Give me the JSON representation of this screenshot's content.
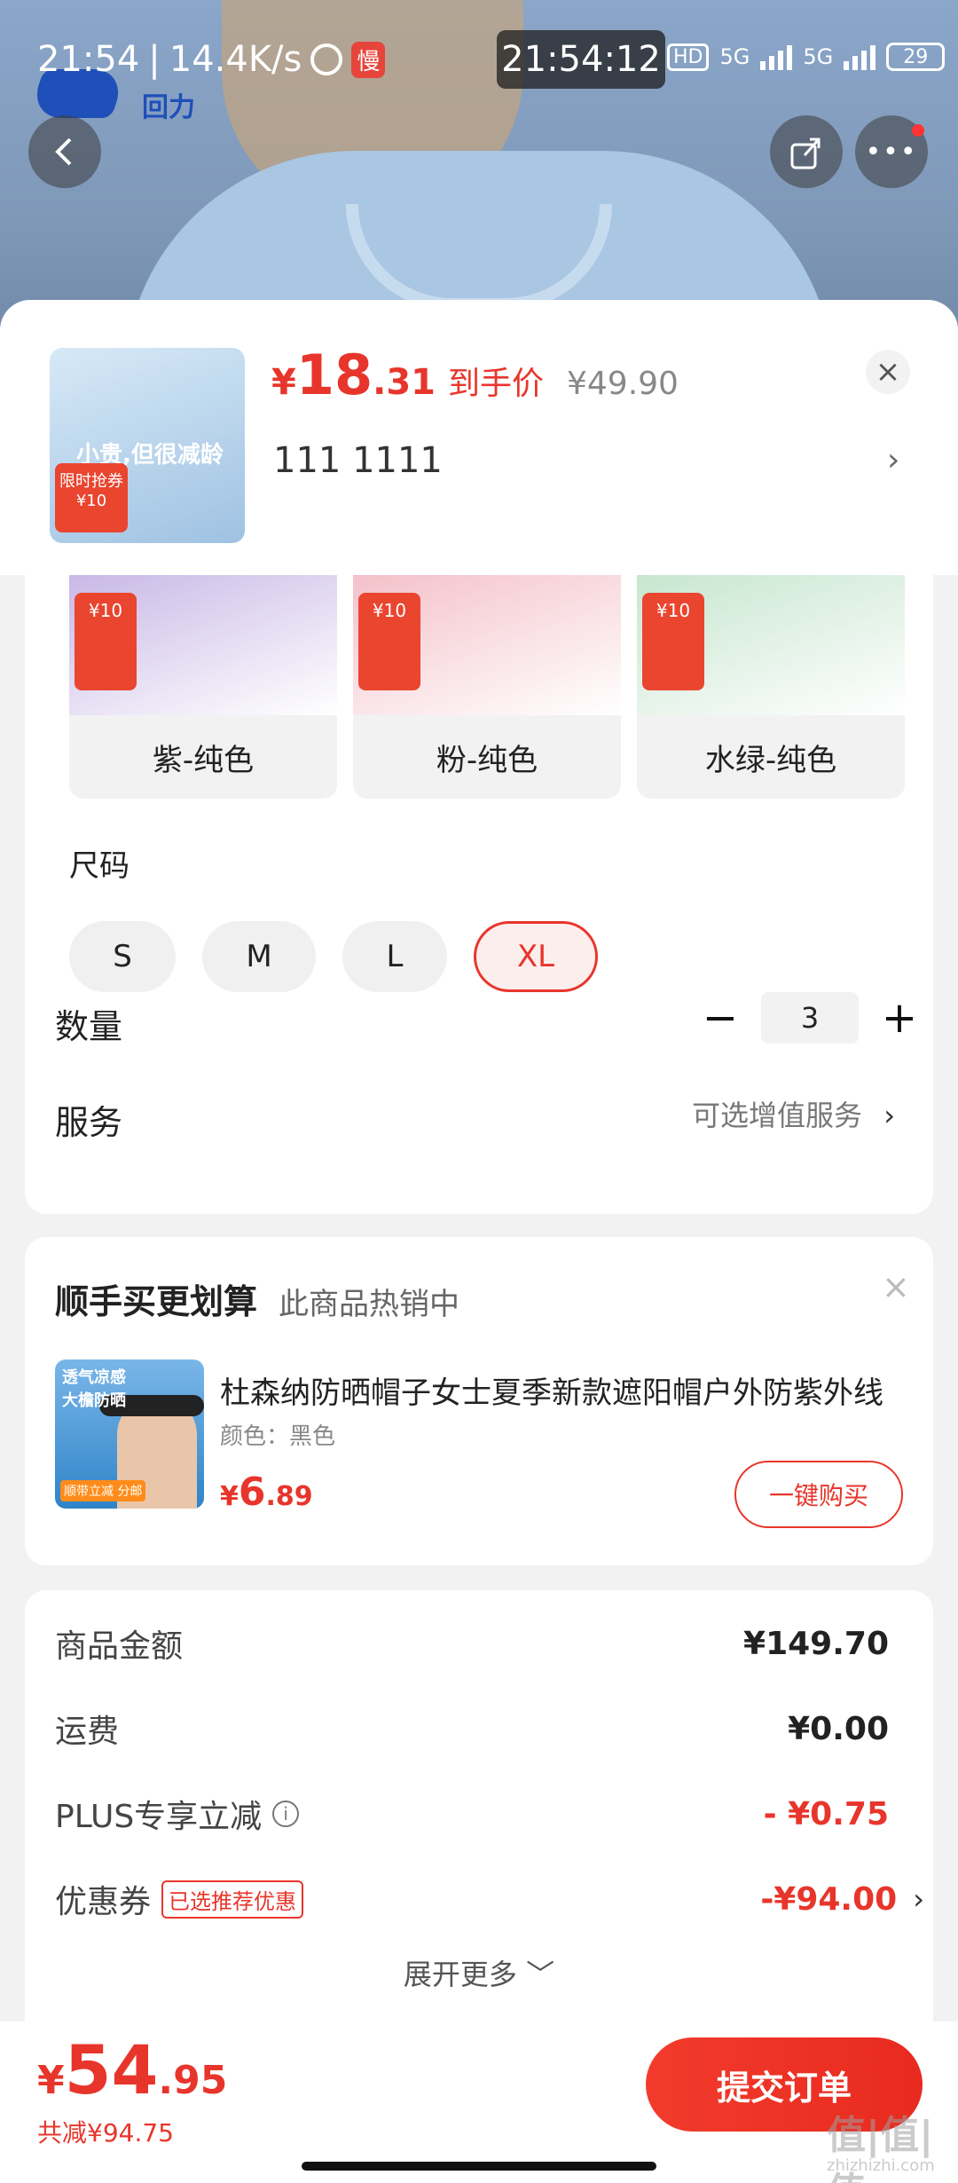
{
  "status_bar": {
    "clock": "21:54",
    "speed": "14.4K/s",
    "slow_badge": "慢",
    "center_time": "21:54:12",
    "hd": "HD",
    "net1": "5G",
    "net2": "5G",
    "battery": "29"
  },
  "background": {
    "brand_text": "回力"
  },
  "nav": {
    "back_icon": "back-arrow-icon",
    "share_icon": "share-icon",
    "more_icon": "more-dots-icon",
    "more_label": "•••"
  },
  "product": {
    "price_symbol": "¥",
    "price_int": "18",
    "price_dec": ".31",
    "price_label": "到手价",
    "original_price": "¥49.90",
    "selected_spec": "111  1111",
    "thumb_slogan": "小贵,但很减龄",
    "thumb_tag": "限时抢券 ¥10"
  },
  "colors": [
    {
      "name": "紫-纯色",
      "swatch": "#c9b8e6",
      "tag": "¥10"
    },
    {
      "name": "粉-纯色",
      "swatch": "#f4c1c9",
      "tag": "¥10"
    },
    {
      "name": "水绿-纯色",
      "swatch": "#c7e6cf",
      "tag": "¥10"
    }
  ],
  "size": {
    "title": "尺码",
    "options": [
      {
        "label": "S",
        "selected": false
      },
      {
        "label": "M",
        "selected": false
      },
      {
        "label": "L",
        "selected": false
      },
      {
        "label": "XL",
        "selected": true
      }
    ]
  },
  "quantity": {
    "label": "数量",
    "minus": "−",
    "value": "3",
    "plus": "+"
  },
  "service": {
    "label": "服务",
    "value": "可选增值服务",
    "arrow": "›"
  },
  "addon": {
    "title": "顺手买更划算",
    "subtitle": "此商品热销中",
    "close": "×",
    "image_text": "透气凉感\n大檐防晒",
    "image_badge": "顺带立减 分邮",
    "name": "杜森纳防晒帽子女士夏季新款遮阳帽户外防紫外线",
    "color": "颜色：黑色",
    "price_symbol": "¥",
    "price_int": "6",
    "price_dec": ".89",
    "button": "一键购买"
  },
  "summary": {
    "rows": [
      {
        "label": "商品金额",
        "value": "¥149.70"
      },
      {
        "label": "运费",
        "value": "¥0.00"
      },
      {
        "label": "PLUS专享立减",
        "value": "- ¥0.75"
      },
      {
        "label": "优惠券",
        "value": "-¥94.00",
        "badge": "已选推荐优惠"
      }
    ],
    "info_icon": "i",
    "expand": "展开更多 ﹀"
  },
  "bottom": {
    "total_symbol": "¥",
    "total_int": "54",
    "total_dec": ".95",
    "saved": "共减¥94.75",
    "submit": "提交订单"
  },
  "watermark": {
    "main": "值|值|值",
    "sub": "zhizhizhi.com"
  },
  "accent": "#e8352b"
}
